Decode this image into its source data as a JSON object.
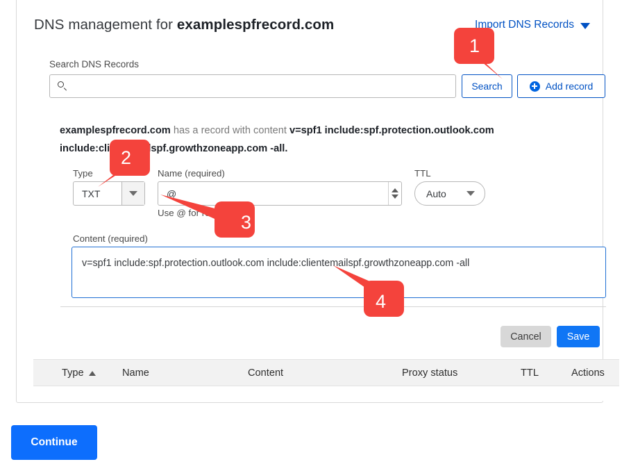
{
  "header": {
    "title_prefix": "DNS management for ",
    "domain": "examplespfrecord.com",
    "import_link": "Import DNS Records",
    "caret_icon": "chevron-down-icon"
  },
  "search": {
    "label": "Search DNS Records",
    "value": "",
    "placeholder": "",
    "icon": "search-icon",
    "search_button": "Search",
    "add_record_button": "Add record",
    "add_icon": "plus-circle-icon"
  },
  "record_notice": {
    "domain": "examplespfrecord.com",
    "middle": " has a record with content ",
    "content": "v=spf1 include:spf.protection.outlook.com include:clientemailspf.growthzoneapp.com -all",
    "period": "."
  },
  "form": {
    "type": {
      "label": "Type",
      "value": "TXT",
      "arrow_icon": "triangle-down-icon"
    },
    "name": {
      "label": "Name (required)",
      "value": "@",
      "hint": "Use @ for root",
      "spinner_up_icon": "triangle-up-icon",
      "spinner_down_icon": "triangle-down-icon"
    },
    "ttl": {
      "label": "TTL",
      "value": "Auto",
      "arrow_icon": "triangle-down-icon"
    },
    "content": {
      "label": "Content (required)",
      "value": "v=spf1 include:spf.protection.outlook.com include:clientemailspf.growthzoneapp.com -all"
    },
    "cancel_button": "Cancel",
    "save_button": "Save"
  },
  "table": {
    "headers": {
      "type": "Type",
      "name": "Name",
      "content": "Content",
      "proxy_status": "Proxy status",
      "ttl": "TTL",
      "actions": "Actions"
    },
    "sort_icon": "sort-ascending-icon"
  },
  "footer": {
    "continue_button": "Continue"
  },
  "callouts": [
    {
      "number": "1"
    },
    {
      "number": "2"
    },
    {
      "number": "3"
    },
    {
      "number": "4"
    }
  ],
  "colors": {
    "accent_blue": "#0d6efd",
    "link_blue": "#0051c3",
    "callout_red": "#f4433c",
    "save_blue": "#1076f5"
  }
}
